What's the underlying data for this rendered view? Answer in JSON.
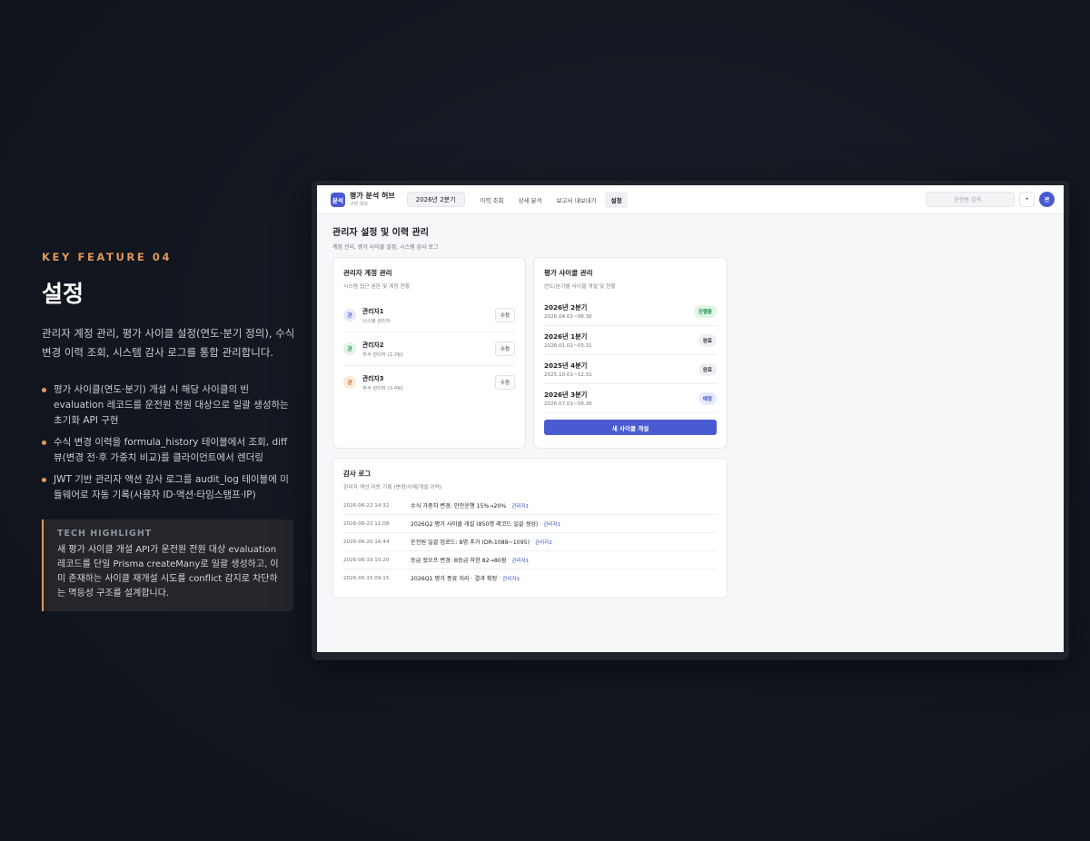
{
  "left": {
    "kicker": "KEY FEATURE 04",
    "title": "설정",
    "description": "관리자 계정 관리, 평가 사이클 설정(연도·분기 정의), 수식 변경 이력 조회, 시스템 감사 로그를 통합 관리합니다.",
    "bullets": [
      "평가 사이클(연도·분기) 개설 시 해당 사이클의 빈 evaluation 레코드를 운전원 전원 대상으로 일괄 생성하는 초기화 API 구현",
      "수식 변경 이력을 formula_history 테이블에서 조회, diff 뷰(변경 전·후 가중치 비교)를 클라이언트에서 렌더링",
      "JWT 기반 관리자 액션 감사 로그를 audit_log 테이블에 미들웨어로 자동 기록(사용자 ID·액션·타임스탬프·IP)"
    ],
    "tech": {
      "title": "TECH HIGHLIGHT",
      "text": "새 평가 사이클 개설 API가 운전원 전원 대상 evaluation 레코드를 단일 Prisma createMany로 일괄 생성하고, 이미 존재하는 사이클 재개설 시도를 conflict 감지로 차단하는 멱등성 구조를 설계합니다."
    }
  },
  "app": {
    "logo": "분석",
    "brand_name": "평가 분석 허브",
    "brand_sub": "구현 데모",
    "quarter": "2026년 2분기",
    "nav": [
      "이력 조회",
      "상세 분석",
      "보고서 내보내기",
      "설정"
    ],
    "nav_active": "설정",
    "search_placeholder": "운전원 검색...",
    "bell": "•",
    "avatar": "관"
  },
  "page": {
    "title": "관리자 설정 및 이력 관리",
    "subtitle": "계정 관리, 평가 사이클 설정, 시스템 감사 로그"
  },
  "admins": {
    "title": "관리자 계정 관리",
    "subtitle": "시스템 접근 권한 및 계정 현황",
    "edit_label": "수정",
    "items": [
      {
        "avatar": "관",
        "name": "관리자1",
        "role": "시스템 관리자",
        "color": "#e6e9fb",
        "text_color": "#4a5bd1"
      },
      {
        "avatar": "관",
        "name": "관리자2",
        "role": "부서 관리자 (1·2팀)",
        "color": "#def4e6",
        "text_color": "#1f8a48"
      },
      {
        "avatar": "관",
        "name": "관리자3",
        "role": "부서 관리자 (3·4팀)",
        "color": "#fcead9",
        "text_color": "#c26a20"
      }
    ]
  },
  "cycles": {
    "title": "평가 사이클 관리",
    "subtitle": "연도/분기별 사이클 개설 및 현황",
    "items": [
      {
        "name": "2026년 2분기",
        "range": "2026.04.01~06.30",
        "status": "진행중",
        "kind": "active"
      },
      {
        "name": "2026년 1분기",
        "range": "2026.01.01~03.31",
        "status": "완료",
        "kind": "done"
      },
      {
        "name": "2025년 4분기",
        "range": "2025.10.01~12.31",
        "status": "완료",
        "kind": "done"
      },
      {
        "name": "2026년 3분기",
        "range": "2026.07.01~09.30",
        "status": "예정",
        "kind": "plan"
      }
    ],
    "new_button": "새 사이클 개설"
  },
  "audit": {
    "title": "감사 로그",
    "subtitle": "관리자 액션 자동 기록 (변경/삭제/개설 이력)",
    "items": [
      {
        "time": "2026-06-22 14:32",
        "action": "수식 가중치 변경: 안전운행 15%→20%",
        "user": "관리자1"
      },
      {
        "time": "2026-06-22 11:08",
        "action": "2026Q2 평가 사이클 개설 (850명 레코드 일괄 생성)",
        "user": "관리자1"
      },
      {
        "time": "2026-06-20 16:44",
        "action": "운전원 일괄 업로드: 8명 추가 (DR-1088~1095)",
        "user": "관리자2"
      },
      {
        "time": "2026-06-19 10:20",
        "action": "등급 컷오프 변경: B등급 하한 82→80점",
        "user": "관리자1"
      },
      {
        "time": "2026-06-15 09:15",
        "action": "2026Q1 평가 종료 처리 · 결과 확정",
        "user": "관리자1"
      }
    ]
  }
}
